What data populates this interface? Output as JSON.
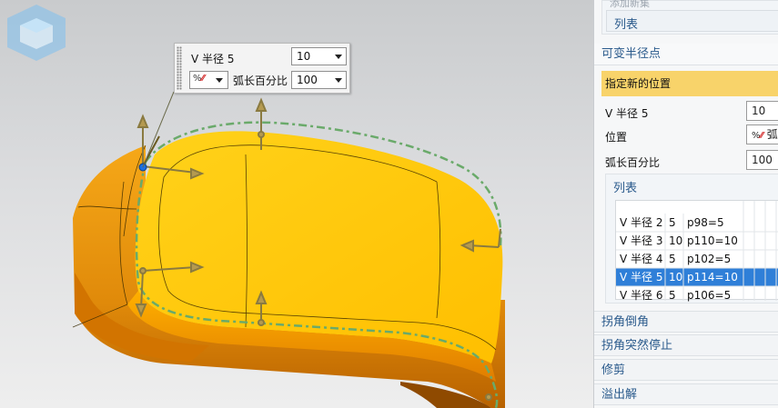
{
  "float_dialog": {
    "v_radius_label": "V 半径 5",
    "v_radius_value": "10",
    "percent_icon": "percent-arc-icon",
    "arc_percent_label": "弧长百分比",
    "arc_percent_value": "100"
  },
  "panel": {
    "top_faint_label": "添加新集",
    "top_list_label": "列表",
    "section_title": "可变半径点",
    "specify_location": "指定新的位置",
    "v_radius_label": "V 半径 5",
    "v_radius_value": "10",
    "location_label": "位置",
    "location_value": "弧",
    "arc_percent_label": "弧长百分比",
    "arc_percent_value": "100",
    "list_title": "列表",
    "list_rows": [
      {
        "name": "V 半径 2",
        "value": "5",
        "point": "p98=5",
        "selected": false
      },
      {
        "name": "V 半径 3",
        "value": "10",
        "point": "p110=10",
        "selected": false
      },
      {
        "name": "V 半径 4",
        "value": "5",
        "point": "p102=5",
        "selected": false
      },
      {
        "name": "V 半径 5",
        "value": "10",
        "point": "p114=10",
        "selected": true
      },
      {
        "name": "V 半径 6",
        "value": "5",
        "point": "p106=5",
        "selected": false
      }
    ],
    "collapsed_sections": [
      "拐角倒角",
      "拐角突然停止",
      "修剪",
      "溢出解"
    ]
  },
  "colors": {
    "model_face": "#ffc400",
    "model_side": "#f29a10",
    "model_dark": "#c26a00",
    "preview_dash": "#6aaa6a",
    "selection": "#2f7fd8",
    "highlight": "#f8d36a",
    "section_text": "#2a5a8c"
  }
}
